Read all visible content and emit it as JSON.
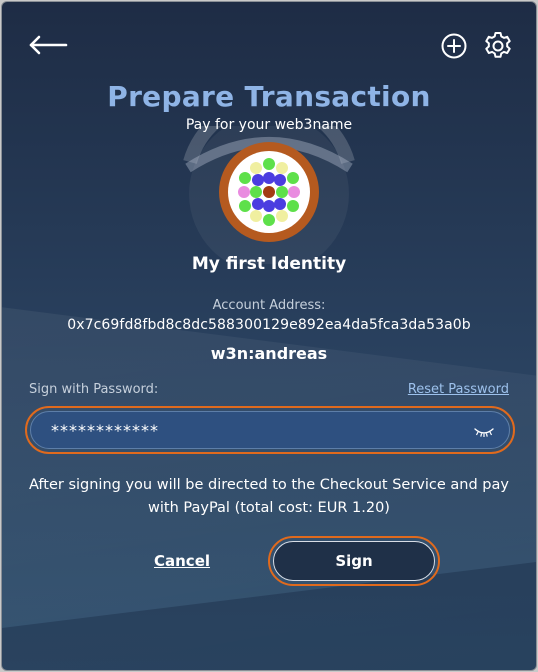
{
  "header": {
    "back_icon": "arrow-left-icon",
    "add_icon": "plus-circle-icon",
    "settings_icon": "gear-icon"
  },
  "title": "Prepare Transaction",
  "subtitle": "Pay for your web3name",
  "identity": {
    "name": "My first Identity",
    "account_label": "Account Address:",
    "account_address": "0x7c69fd8fbd8c8dc588300129e892ea4da5fca3da53a0b",
    "web3name": "w3n:andreas"
  },
  "password": {
    "label": "Sign with Password:",
    "reset_label": "Reset Password",
    "value": "************",
    "toggle_icon": "eye-closed-icon"
  },
  "info_text": "After signing you will be directed to the Checkout Service and pay with PayPal (total cost: EUR 1.20)",
  "actions": {
    "cancel_label": "Cancel",
    "sign_label": "Sign"
  },
  "colors": {
    "accent_orange": "#e06a1d",
    "title_blue": "#8fb4e6",
    "link_blue": "#9dc1ec"
  }
}
